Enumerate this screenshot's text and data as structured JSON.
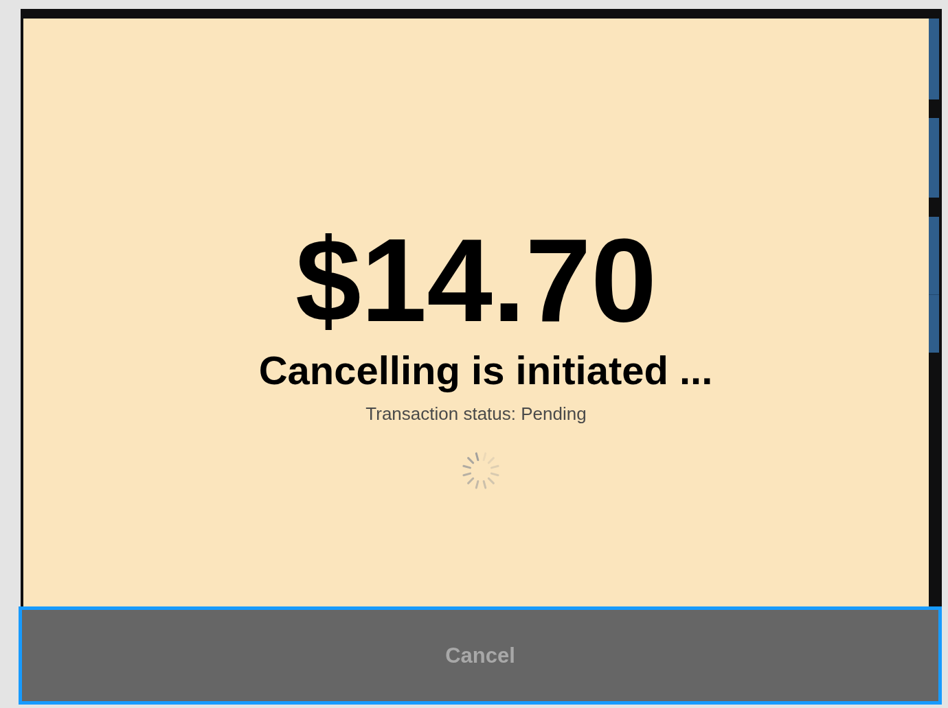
{
  "dialog": {
    "amount": "$14.70",
    "title": "Cancelling is initiated ...",
    "status": "Transaction status: Pending",
    "loading": true
  },
  "cancel_button": {
    "label": "Cancel",
    "disabled": true,
    "focused": true
  }
}
